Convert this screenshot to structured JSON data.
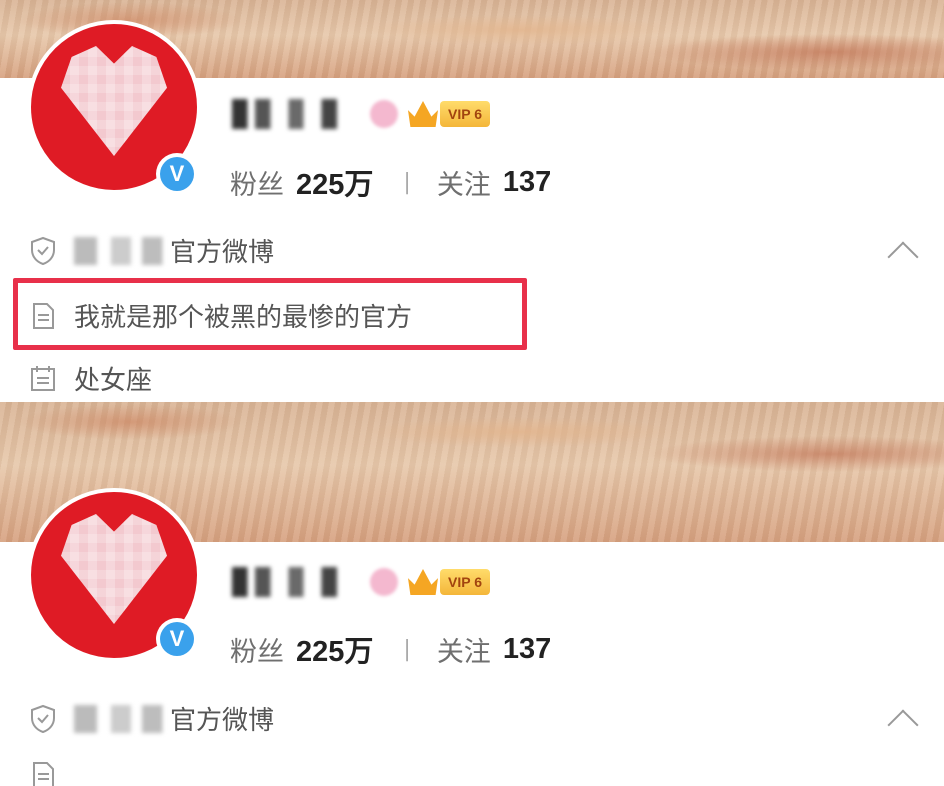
{
  "profile": {
    "official_suffix": "官方微博",
    "description": "我就是那个被黑的最惨的官方",
    "zodiac": "处女座",
    "vip_label": "VIP 6",
    "followers_label": "粉丝",
    "followers_value": "225万",
    "following_label": "关注",
    "following_value": "137",
    "separator": "|",
    "verified_mark": "V"
  },
  "colors": {
    "avatar_red": "#df1b25",
    "verified_blue": "#3aa1ec",
    "highlight_red": "#e8304a",
    "vip_gold": "#f4b63a"
  }
}
